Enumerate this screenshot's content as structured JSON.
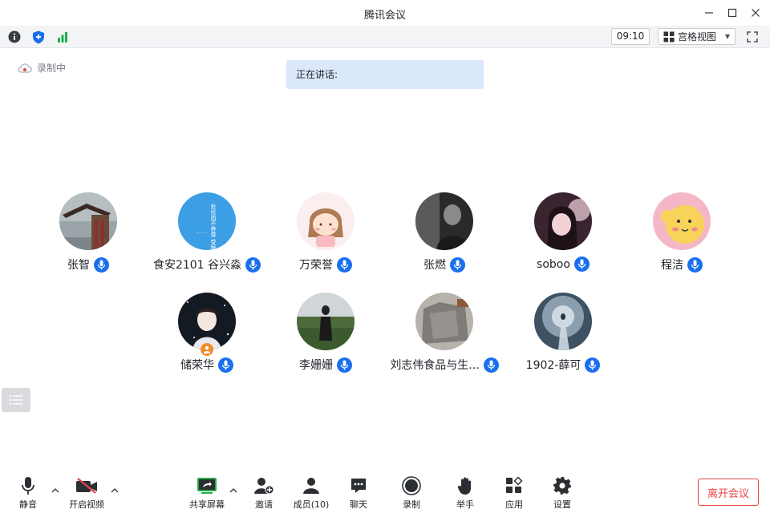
{
  "window": {
    "title": "腾讯会议"
  },
  "toolbar": {
    "clock": "09:10",
    "view_label": "宫格视图"
  },
  "status": {
    "recording_label": "录制中",
    "speaking_label": "正在讲话:"
  },
  "participants": [
    {
      "name": "张智"
    },
    {
      "name": "食安2101 谷兴淼"
    },
    {
      "name": "万荣誉"
    },
    {
      "name": "张燃"
    },
    {
      "name": "soboo"
    },
    {
      "name": "程洁"
    },
    {
      "name": "储荣华"
    },
    {
      "name": "李姗姗"
    },
    {
      "name": "刘志伟食品与生..."
    },
    {
      "name": "1902-薛可"
    }
  ],
  "avatar_text": {
    "poem": "处优而不养尊 受挫而不短志"
  },
  "bottombar": {
    "mute": "静音",
    "video": "开启视频",
    "share": "共享屏幕",
    "invite": "邀请",
    "members": "成员(10)",
    "chat": "聊天",
    "record": "录制",
    "raise_hand": "举手",
    "apps": "应用",
    "settings": "设置",
    "leave": "离开会议"
  },
  "colors": {
    "accent": "#1a6ff0",
    "leave": "#e54545",
    "speaking_bg": "#dbe8fb",
    "signal": "#22b14c",
    "host_badge": "#f38b2a"
  }
}
